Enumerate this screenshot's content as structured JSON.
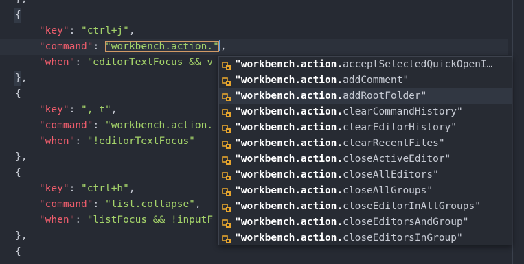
{
  "editor": {
    "lines": [
      {
        "indent": "",
        "tokens": [
          {
            "t": "},",
            "c": "punc"
          }
        ]
      },
      {
        "indent": "",
        "tokens": [
          {
            "t": "{",
            "c": "punc"
          }
        ],
        "gutter_marker": true
      },
      {
        "indent": "    ",
        "tokens": [
          {
            "t": "\"key\"",
            "c": "key"
          },
          {
            "t": ": ",
            "c": "punc"
          },
          {
            "t": "\"ctrl+j\"",
            "c": "str"
          },
          {
            "t": ",",
            "c": "punc"
          }
        ]
      },
      {
        "indent": "    ",
        "tokens": [
          {
            "t": "\"command\"",
            "c": "key"
          },
          {
            "t": ": ",
            "c": "punc"
          },
          {
            "t": "\"workbench.action.\"",
            "c": "sel"
          },
          {
            "t": ",",
            "c": "punc"
          }
        ],
        "current": true
      },
      {
        "indent": "    ",
        "tokens": [
          {
            "t": "\"when\"",
            "c": "key"
          },
          {
            "t": ": ",
            "c": "punc"
          },
          {
            "t": "\"editorTextFocus && v",
            "c": "str"
          }
        ]
      },
      {
        "indent": "",
        "tokens": [
          {
            "t": "},",
            "c": "punc"
          }
        ],
        "gutter_marker": true
      },
      {
        "indent": "",
        "tokens": [
          {
            "t": "{",
            "c": "punc"
          }
        ]
      },
      {
        "indent": "    ",
        "tokens": [
          {
            "t": "\"key\"",
            "c": "key"
          },
          {
            "t": ": ",
            "c": "punc"
          },
          {
            "t": "\", t\"",
            "c": "str"
          },
          {
            "t": ",",
            "c": "punc"
          }
        ]
      },
      {
        "indent": "    ",
        "tokens": [
          {
            "t": "\"command\"",
            "c": "key"
          },
          {
            "t": ": ",
            "c": "punc"
          },
          {
            "t": "\"workbench.action.",
            "c": "str"
          }
        ]
      },
      {
        "indent": "    ",
        "tokens": [
          {
            "t": "\"when\"",
            "c": "key"
          },
          {
            "t": ": ",
            "c": "punc"
          },
          {
            "t": "\"!editorTextFocus\"",
            "c": "str"
          }
        ]
      },
      {
        "indent": "",
        "tokens": [
          {
            "t": "},",
            "c": "punc"
          }
        ]
      },
      {
        "indent": "",
        "tokens": [
          {
            "t": "{",
            "c": "punc"
          }
        ]
      },
      {
        "indent": "    ",
        "tokens": [
          {
            "t": "\"key\"",
            "c": "key"
          },
          {
            "t": ": ",
            "c": "punc"
          },
          {
            "t": "\"ctrl+h\"",
            "c": "str"
          },
          {
            "t": ",",
            "c": "punc"
          }
        ]
      },
      {
        "indent": "    ",
        "tokens": [
          {
            "t": "\"command\"",
            "c": "key"
          },
          {
            "t": ": ",
            "c": "punc"
          },
          {
            "t": "\"list.collapse\"",
            "c": "str"
          },
          {
            "t": ",",
            "c": "punc"
          }
        ]
      },
      {
        "indent": "    ",
        "tokens": [
          {
            "t": "\"when\"",
            "c": "key"
          },
          {
            "t": ": ",
            "c": "punc"
          },
          {
            "t": "\"listFocus && !inputF",
            "c": "str"
          }
        ]
      },
      {
        "indent": "",
        "tokens": [
          {
            "t": "},",
            "c": "punc"
          }
        ]
      },
      {
        "indent": "",
        "tokens": [
          {
            "t": "{",
            "c": "punc"
          }
        ]
      }
    ]
  },
  "suggest": {
    "icon": "method-cube-icon",
    "icon_color": "#e5a42e",
    "match_prefix": "\"workbench.action.",
    "selected_index": 2,
    "items": [
      {
        "rest": "acceptSelectedQuickOpenI…"
      },
      {
        "rest": "addComment\""
      },
      {
        "rest": "addRootFolder\""
      },
      {
        "rest": "clearCommandHistory\""
      },
      {
        "rest": "clearEditorHistory\""
      },
      {
        "rest": "clearRecentFiles\""
      },
      {
        "rest": "closeActiveEditor\""
      },
      {
        "rest": "closeAllEditors\""
      },
      {
        "rest": "closeAllGroups\""
      },
      {
        "rest": "closeEditorInAllGroups\""
      },
      {
        "rest": "closeEditorsAndGroup\""
      },
      {
        "rest": "closeEditorsInGroup\""
      }
    ]
  },
  "colors": {
    "background": "#262a33",
    "key": "#ee5d6c",
    "string": "#a5d46a",
    "punctuation": "#c7cbd4",
    "cursor": "#5aa0e6",
    "selection_outline": "#d19a66"
  }
}
